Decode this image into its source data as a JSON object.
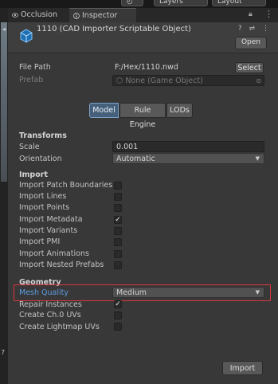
{
  "topbar": {
    "layers_label": "Layers",
    "layout_label": "Layout"
  },
  "left_strip": {
    "severity_label": "7"
  },
  "tabs": [
    {
      "label": "Occlusion"
    },
    {
      "label": "Inspector"
    }
  ],
  "header": {
    "title": "1110 (CAD Importer Scriptable Object)",
    "open_label": "Open",
    "icon_help": "?",
    "icon_settings": "⇌",
    "icon_more": "⋮"
  },
  "file": {
    "path_label": "File Path",
    "path_value": "F:/Hex/1110.nwd",
    "select_label": "Select",
    "prefab_label": "Prefab",
    "prefab_value": "None (Game Object)"
  },
  "mode_tabs": [
    {
      "label": "Model",
      "selected": true
    },
    {
      "label": "Rule Engine",
      "selected": false
    },
    {
      "label": "LODs",
      "selected": false
    }
  ],
  "transforms": {
    "heading": "Transforms",
    "scale_label": "Scale",
    "scale_value": "0.001",
    "orientation_label": "Orientation",
    "orientation_value": "Automatic"
  },
  "import": {
    "heading": "Import",
    "options": [
      {
        "label": "Import Patch Boundaries",
        "checked": false
      },
      {
        "label": "Import Lines",
        "checked": false
      },
      {
        "label": "Import Points",
        "checked": false
      },
      {
        "label": "Import Metadata",
        "checked": true
      },
      {
        "label": "Import Variants",
        "checked": false
      },
      {
        "label": "Import PMI",
        "checked": false
      },
      {
        "label": "Import Animations",
        "checked": false
      },
      {
        "label": "Import Nested Prefabs",
        "checked": false
      }
    ]
  },
  "geometry": {
    "heading": "Geometry",
    "mesh_quality_label": "Mesh Quality",
    "mesh_quality_value": "Medium",
    "options": [
      {
        "label": "Repair Instances",
        "checked": true
      },
      {
        "label": "Create Ch.0 UVs",
        "checked": false
      },
      {
        "label": "Create Lightmap UVs",
        "checked": false
      }
    ]
  },
  "footer": {
    "import_label": "Import"
  },
  "colors": {
    "background": "#383838",
    "selected_tab": "#46607c",
    "highlight_border": "#d9373c",
    "mesh_quality_label": "#5c9be0"
  },
  "icons": {
    "occlusion_tab": "eye-icon",
    "inspector_tab": "info-icon",
    "object": "cube-icon",
    "lock": "lock-icon",
    "prefab": "prefab-icon",
    "target": "object-picker-icon",
    "dropdown": "chevron-down-icon",
    "check": "checkmark-icon"
  }
}
